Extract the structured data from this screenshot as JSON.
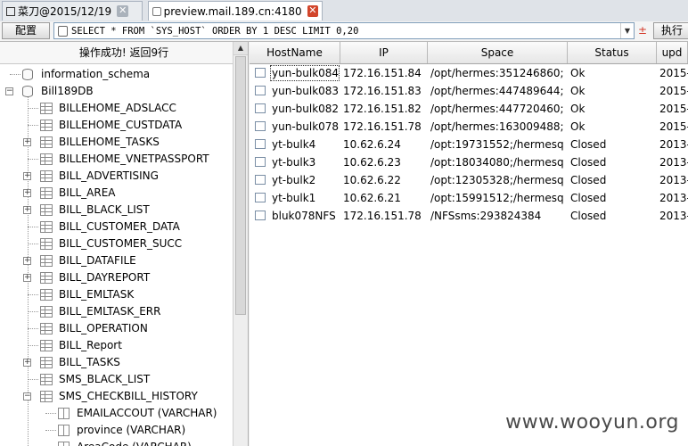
{
  "tabs": [
    {
      "label": "菜刀@2015/12/19",
      "active": false
    },
    {
      "label": "preview.mail.189.cn:4180",
      "active": true
    }
  ],
  "toolbar": {
    "config_label": "配置",
    "sql_value": "SELECT * FROM `SYS_HOST` ORDER BY 1 DESC LIMIT 0,20",
    "plusminus": "±",
    "execute_label": "执行"
  },
  "left": {
    "status_text": "操作成功! 返回9行",
    "tree": [
      {
        "label": "information_schema",
        "kind": "db",
        "level": 0,
        "expander": ""
      },
      {
        "label": "Bill189DB",
        "kind": "db",
        "level": 0,
        "expander": "−"
      },
      {
        "label": "BILLEHOME_ADSLACC",
        "kind": "table",
        "level": 1,
        "expander": ""
      },
      {
        "label": "BILLEHOME_CUSTDATA",
        "kind": "table",
        "level": 1,
        "expander": ""
      },
      {
        "label": "BILLEHOME_TASKS",
        "kind": "table",
        "level": 1,
        "expander": "+"
      },
      {
        "label": "BILLEHOME_VNETPASSPORT",
        "kind": "table",
        "level": 1,
        "expander": ""
      },
      {
        "label": "BILL_ADVERTISING",
        "kind": "table",
        "level": 1,
        "expander": "+"
      },
      {
        "label": "BILL_AREA",
        "kind": "table",
        "level": 1,
        "expander": "+"
      },
      {
        "label": "BILL_BLACK_LIST",
        "kind": "table",
        "level": 1,
        "expander": "+"
      },
      {
        "label": "BILL_CUSTOMER_DATA",
        "kind": "table",
        "level": 1,
        "expander": ""
      },
      {
        "label": "BILL_CUSTOMER_SUCC",
        "kind": "table",
        "level": 1,
        "expander": ""
      },
      {
        "label": "BILL_DATAFILE",
        "kind": "table",
        "level": 1,
        "expander": "+"
      },
      {
        "label": "BILL_DAYREPORT",
        "kind": "table",
        "level": 1,
        "expander": "+"
      },
      {
        "label": "BILL_EMLTASK",
        "kind": "table",
        "level": 1,
        "expander": ""
      },
      {
        "label": "BILL_EMLTASK_ERR",
        "kind": "table",
        "level": 1,
        "expander": ""
      },
      {
        "label": "BILL_OPERATION",
        "kind": "table",
        "level": 1,
        "expander": ""
      },
      {
        "label": "BILL_Report",
        "kind": "table",
        "level": 1,
        "expander": ""
      },
      {
        "label": "BILL_TASKS",
        "kind": "table",
        "level": 1,
        "expander": "+"
      },
      {
        "label": "SMS_BLACK_LIST",
        "kind": "table",
        "level": 1,
        "expander": ""
      },
      {
        "label": "SMS_CHECKBILL_HISTORY",
        "kind": "table",
        "level": 1,
        "expander": "−"
      },
      {
        "label": "EMAILACCOUT (VARCHAR)",
        "kind": "column",
        "level": 2,
        "expander": ""
      },
      {
        "label": "province (VARCHAR)",
        "kind": "column",
        "level": 2,
        "expander": ""
      },
      {
        "label": "AreaCode (VARCHAR)",
        "kind": "column",
        "level": 2,
        "expander": ""
      }
    ]
  },
  "grid": {
    "columns": [
      "HostName",
      "IP",
      "Space",
      "Status",
      "upd"
    ],
    "rows": [
      [
        "yun-bulk084",
        "172.16.151.84",
        "/opt/hermes:351246860;",
        "Ok",
        "2015-"
      ],
      [
        "yun-bulk083",
        "172.16.151.83",
        "/opt/hermes:447489644;",
        "Ok",
        "2015-"
      ],
      [
        "yun-bulk082",
        "172.16.151.82",
        "/opt/hermes:447720460;",
        "Ok",
        "2015-"
      ],
      [
        "yun-bulk078",
        "172.16.151.78",
        "/opt/hermes:163009488;",
        "Ok",
        "2015-"
      ],
      [
        "yt-bulk4",
        "10.62.6.24",
        "/opt:19731552;/hermesq",
        "Closed",
        "2013-"
      ],
      [
        "yt-bulk3",
        "10.62.6.23",
        "/opt:18034080;/hermesq",
        "Closed",
        "2013-"
      ],
      [
        "yt-bulk2",
        "10.62.6.22",
        "/opt:12305328;/hermesq",
        "Closed",
        "2013-"
      ],
      [
        "yt-bulk1",
        "10.62.6.21",
        "/opt:15991512;/hermesq",
        "Closed",
        "2013-"
      ],
      [
        "bluk078NFS",
        "172.16.151.78",
        "/NFSsms:293824384",
        "Closed",
        "2013-"
      ]
    ]
  },
  "watermark": "www.wooyun.org"
}
